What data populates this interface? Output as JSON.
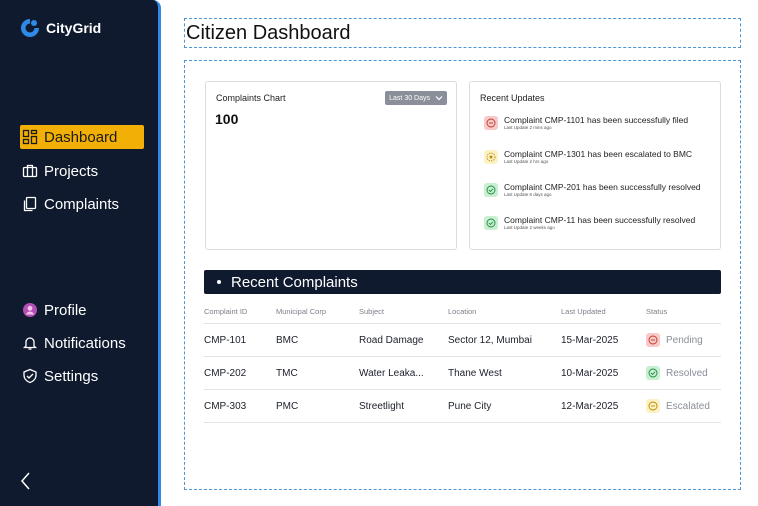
{
  "app": {
    "name": "CityGrid"
  },
  "nav": {
    "dashboard": "Dashboard",
    "projects": "Projects",
    "complaints": "Complaints",
    "profile": "Profile",
    "notifications": "Notifications",
    "settings": "Settings"
  },
  "page": {
    "title": "Citizen Dashboard"
  },
  "chart_card": {
    "title": "Complaints Chart",
    "value": "100",
    "range": "Last 30 Days"
  },
  "updates": {
    "title": "Recent Updates",
    "items": [
      {
        "text": "Complaint CMP-1101 has been successfully filed",
        "time": "Last Update 2 mins ago",
        "status": "filed"
      },
      {
        "text": "Complaint CMP-1301 has been escalated to BMC",
        "time": "Last Update 2 hrs ago",
        "status": "escalated"
      },
      {
        "text": "Complaint CMP-201 has been successfully resolved",
        "time": "Last Update 6 days ago",
        "status": "resolved"
      },
      {
        "text": "Complaint CMP-11 has been successfully resolved",
        "time": "Last Update 2 weeks ago",
        "status": "resolved"
      }
    ]
  },
  "recent": {
    "title": "Recent Complaints",
    "columns": [
      "Complaint ID",
      "Municipal Corp",
      "Subject",
      "Location",
      "Last Updated",
      "Status"
    ],
    "rows": [
      {
        "id": "CMP-101",
        "corp": "BMC",
        "subject": "Road Damage",
        "location": "Sector 12, Mumbai",
        "updated": "15-Mar-2025",
        "status": "Pending"
      },
      {
        "id": "CMP-202",
        "corp": "TMC",
        "subject": "Water Leaka...",
        "location": "Thane West",
        "updated": "10-Mar-2025",
        "status": "Resolved"
      },
      {
        "id": "CMP-303",
        "corp": "PMC",
        "subject": "Streetlight",
        "location": "Pune City",
        "updated": "12-Mar-2025",
        "status": "Escalated"
      }
    ]
  },
  "colors": {
    "sidebar": "#0f1a2e",
    "accent": "#f2b006",
    "pending": "#f8c9c9",
    "resolved": "#c9efd3",
    "escalated": "#fdf2c5"
  }
}
